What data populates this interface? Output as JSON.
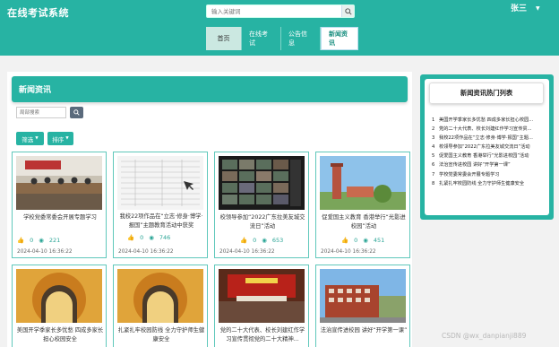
{
  "header": {
    "site_title": "在线考试系统",
    "search_placeholder": "输入关键词",
    "user_name": "张三",
    "colors": {
      "brand": "#27b3a3"
    }
  },
  "nav": {
    "items": [
      {
        "label": "首页"
      },
      {
        "label": "在线考试"
      },
      {
        "label": "公告信息"
      },
      {
        "label": "新闻资讯"
      }
    ],
    "active": "新闻资讯"
  },
  "main": {
    "section_title": "新闻资讯",
    "keyword_placeholder": "局部搜索",
    "filter_label": "筛选",
    "sort_label": "排序"
  },
  "cards": [
    {
      "title": "学校党委常委会开展专题学习",
      "likes": "0",
      "views": "221",
      "date": "2024-04-10 16:36:22",
      "thumb": "meeting"
    },
    {
      "title": "我校22项作品在“立志·修身·博学·报国”主题教育活动中获奖",
      "likes": "0",
      "views": "746",
      "date": "2024-04-10 16:36:22",
      "thumb": "document"
    },
    {
      "title": "校领导参加“2022广东拉美友城交流日”活动",
      "likes": "0",
      "views": "653",
      "date": "2024-04-10 16:36:22",
      "thumb": "video-call"
    },
    {
      "title": "促爱国主义教育 香港举行“光影进校园”活动",
      "likes": "0",
      "views": "451",
      "date": "2024-04-10 16:36:22",
      "thumb": "campus-tower"
    },
    {
      "title": "美国开学季家长多忧愁 四成多家长担心校园安全",
      "thumb": "gate"
    },
    {
      "title": "扎紧扎牢校园防线 全力守护师生健康安全",
      "thumb": "gate"
    },
    {
      "title": "党的二十大代表、校长刘建红作学习宣传贯彻党的二十大精神...",
      "thumb": "hall"
    },
    {
      "title": "法治宣传进校园 讲好“开学第一课”",
      "thumb": "building"
    }
  ],
  "sidebar": {
    "title": "新闻资讯热门列表",
    "items": [
      {
        "n": "1",
        "text": "美国开学季家长多忧愁 四成多家长担心校园..."
      },
      {
        "n": "2",
        "text": "党的二十大代表、校长刘建红作学习宣传贯..."
      },
      {
        "n": "3",
        "text": "我校22项作品在“立志·修身·博学·报国”主题..."
      },
      {
        "n": "4",
        "text": "校领导参加“2022广东拉美友城交流日”活动"
      },
      {
        "n": "5",
        "text": "促爱国主义教育 香港举行“光影进校园”活动"
      },
      {
        "n": "6",
        "text": "法治宣传进校园 讲好“开学第一课”"
      },
      {
        "n": "7",
        "text": "学校党委常委会开展专题学习"
      },
      {
        "n": "8",
        "text": "扎紧扎牢校园防线 全力守护师生健康安全"
      }
    ]
  },
  "watermark": "CSDN @wx_danpianji889"
}
